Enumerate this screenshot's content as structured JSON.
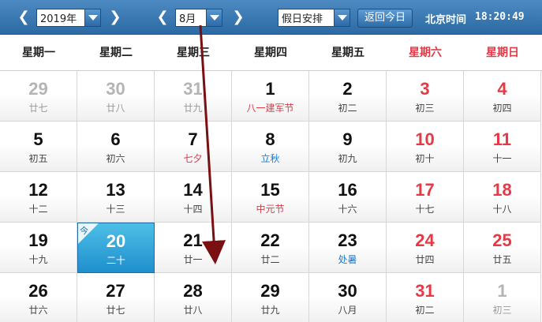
{
  "toolbar": {
    "year": "2019年",
    "month": "8月",
    "holiday": "假日安排",
    "today_button": "返回今日",
    "clock_label": "北京时间",
    "clock_time": "18:20:49",
    "prev_icon": "chevron-left-icon",
    "next_icon": "chevron-right-icon"
  },
  "weekdays": [
    "星期一",
    "星期二",
    "星期三",
    "星期四",
    "星期五",
    "星期六",
    "星期日"
  ],
  "today_tag": "今",
  "colors": {
    "header": "#2c6aa5",
    "weekend": "#e53946",
    "festival": "#e53946",
    "solar_term": "#1a7be0",
    "today": "#1f8fcd"
  },
  "days": [
    {
      "num": "29",
      "sub": "廿七",
      "other": true
    },
    {
      "num": "30",
      "sub": "廿八",
      "other": true
    },
    {
      "num": "31",
      "sub": "廿九",
      "other": true
    },
    {
      "num": "1",
      "sub": "八一建军节",
      "subType": "red"
    },
    {
      "num": "2",
      "sub": "初二"
    },
    {
      "num": "3",
      "sub": "初三",
      "weekend": true
    },
    {
      "num": "4",
      "sub": "初四",
      "weekend": true
    },
    {
      "num": "5",
      "sub": "初五"
    },
    {
      "num": "6",
      "sub": "初六"
    },
    {
      "num": "7",
      "sub": "七夕",
      "subType": "red"
    },
    {
      "num": "8",
      "sub": "立秋",
      "subType": "blue"
    },
    {
      "num": "9",
      "sub": "初九"
    },
    {
      "num": "10",
      "sub": "初十",
      "weekend": true
    },
    {
      "num": "11",
      "sub": "十一",
      "weekend": true
    },
    {
      "num": "12",
      "sub": "十二"
    },
    {
      "num": "13",
      "sub": "十三"
    },
    {
      "num": "14",
      "sub": "十四"
    },
    {
      "num": "15",
      "sub": "中元节",
      "subType": "red"
    },
    {
      "num": "16",
      "sub": "十六"
    },
    {
      "num": "17",
      "sub": "十七",
      "weekend": true
    },
    {
      "num": "18",
      "sub": "十八",
      "weekend": true
    },
    {
      "num": "19",
      "sub": "十九"
    },
    {
      "num": "20",
      "sub": "二十",
      "today": true
    },
    {
      "num": "21",
      "sub": "廿一"
    },
    {
      "num": "22",
      "sub": "廿二"
    },
    {
      "num": "23",
      "sub": "处暑",
      "subType": "blue"
    },
    {
      "num": "24",
      "sub": "廿四",
      "weekend": true
    },
    {
      "num": "25",
      "sub": "廿五",
      "weekend": true
    },
    {
      "num": "26",
      "sub": "廿六"
    },
    {
      "num": "27",
      "sub": "廿七"
    },
    {
      "num": "28",
      "sub": "廿八"
    },
    {
      "num": "29",
      "sub": "廿九"
    },
    {
      "num": "30",
      "sub": "八月"
    },
    {
      "num": "31",
      "sub": "初二",
      "weekend": true
    },
    {
      "num": "1",
      "sub": "初三",
      "other": true
    }
  ]
}
